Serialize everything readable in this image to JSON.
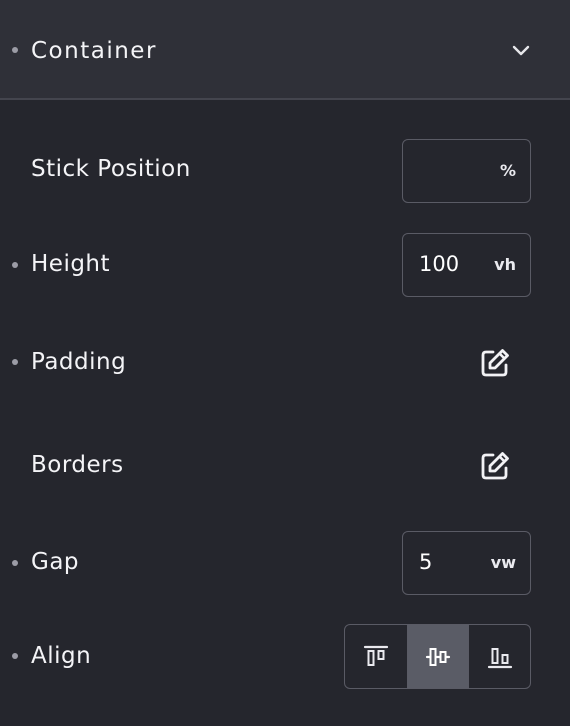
{
  "section": {
    "title": "Container",
    "expanded_icon": "chevron-down-icon"
  },
  "rows": {
    "stick_position": {
      "label": "Stick Position",
      "value": "",
      "unit": "%"
    },
    "height": {
      "label": "Height",
      "value": "100",
      "unit": "vh"
    },
    "padding": {
      "label": "Padding",
      "icon": "edit-icon"
    },
    "borders": {
      "label": "Borders",
      "icon": "edit-icon"
    },
    "gap": {
      "label": "Gap",
      "value": "5",
      "unit": "vw"
    },
    "align": {
      "label": "Align",
      "options": [
        "align-top-icon",
        "align-center-icon",
        "align-bottom-icon"
      ],
      "selected": "align-center-icon"
    }
  },
  "colors": {
    "background": "#25262d",
    "header_background": "#2f3038",
    "border": "#5a5b65",
    "active_segment": "#5a5c66",
    "dot": "#9c9ca6"
  }
}
